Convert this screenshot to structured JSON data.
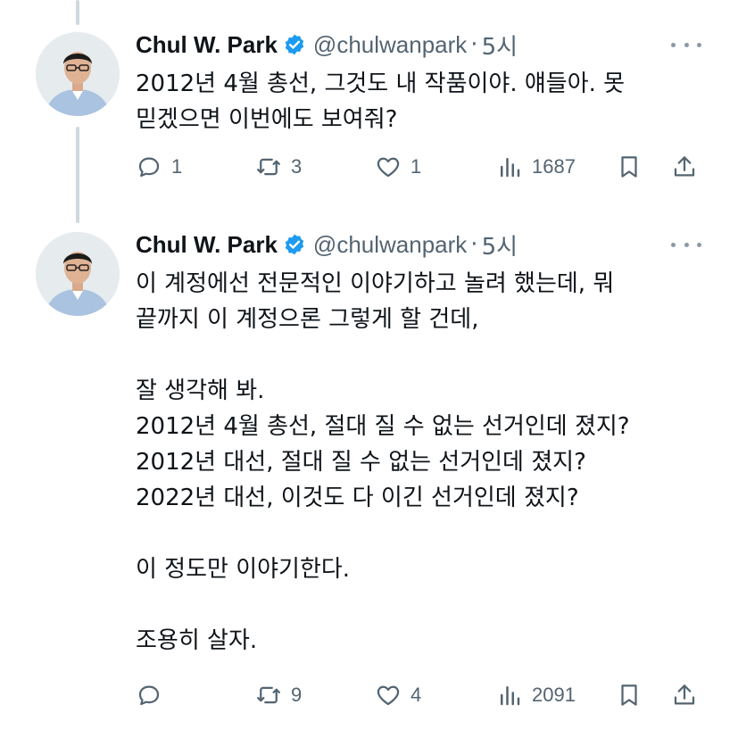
{
  "tweets": [
    {
      "author_name": "Chul W. Park",
      "handle": "@chulwanpark",
      "separator": "·",
      "time": "5시",
      "text": "2012년 4월 총선, 그것도 내 작품이야. 얘들아. 못\n믿겠으면 이번에도 보여줘?",
      "replies": "1",
      "retweets": "3",
      "likes": "1",
      "views": "1687"
    },
    {
      "author_name": "Chul W. Park",
      "handle": "@chulwanpark",
      "separator": "·",
      "time": "5시",
      "text": "이 계정에선 전문적인 이야기하고 놀려 했는데, 뭐\n끝까지 이 계정으론 그렇게 할 건데,\n\n잘 생각해 봐.\n2012년 4월 총선, 절대 질 수 없는 선거인데 졌지?\n2012년 대선, 절대 질 수 없는 선거인데 졌지?\n2022년 대선, 이것도 다 이긴 선거인데 졌지?\n\n이 정도만 이야기한다.\n\n조용히 살자.",
      "replies": "",
      "retweets": "9",
      "likes": "4",
      "views": "2091"
    }
  ],
  "colors": {
    "text": "#0f1419",
    "secondary": "#536471",
    "verified": "#1d9bf0",
    "thread_line": "#cfd9de"
  },
  "icons": [
    "verified-badge-icon",
    "reply-icon",
    "retweet-icon",
    "like-icon",
    "views-icon",
    "bookmark-icon",
    "share-icon",
    "more-icon"
  ]
}
